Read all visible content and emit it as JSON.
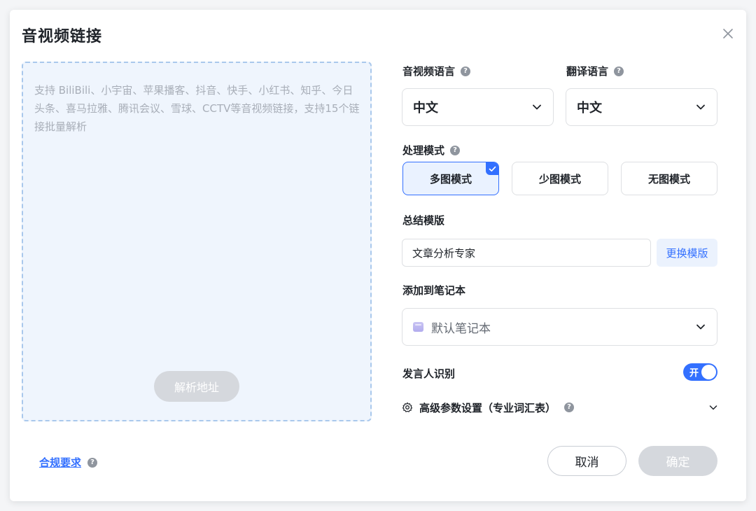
{
  "dialog": {
    "title": "音视频链接",
    "close_icon": "close-icon"
  },
  "link_input": {
    "value": "",
    "placeholder": "支持 BiliBili、小宇宙、苹果播客、抖音、快手、小红书、知乎、今日头条、喜马拉雅、腾讯会议、雪球、CCTV等音视频链接，支持15个链接批量解析",
    "parse_label": "解析地址"
  },
  "settings": {
    "media_language": {
      "label": "音视频语言",
      "value": "中文"
    },
    "translate_language": {
      "label": "翻译语言",
      "value": "中文"
    },
    "process_mode": {
      "label": "处理模式",
      "options": [
        "多图模式",
        "少图模式",
        "无图模式"
      ],
      "selected": "多图模式"
    },
    "summary_template": {
      "label": "总结模版",
      "value": "文章分析专家",
      "swap_label": "更换模版"
    },
    "notebook": {
      "label": "添加到笔记本",
      "value": "默认笔记本"
    },
    "speaker_recognition": {
      "label": "发言人识别",
      "toggle_text": "开",
      "enabled": true
    },
    "advanced": {
      "label": "高级参数设置（专业词汇表）"
    }
  },
  "footer": {
    "compliance_label": "合规要求",
    "cancel_label": "取消",
    "ok_label": "确定"
  },
  "colors": {
    "accent": "#3370ff",
    "dropzone_bg": "#eff5fd",
    "disabled_btn": "#d5d8dd"
  }
}
